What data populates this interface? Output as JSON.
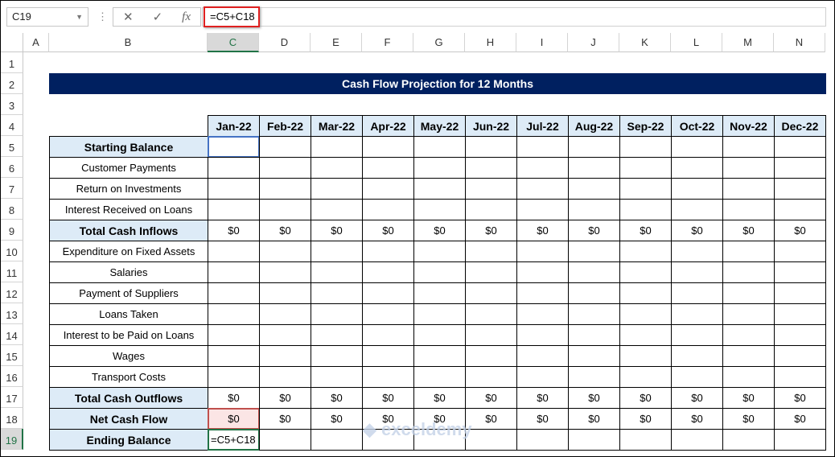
{
  "name_box": "C19",
  "formula_bar": {
    "cancel_icon": "✕",
    "enter_icon": "✓",
    "fx_label": "fx",
    "formula": "=C5+C18"
  },
  "columns": [
    "A",
    "B",
    "C",
    "D",
    "E",
    "F",
    "G",
    "H",
    "I",
    "J",
    "K",
    "L",
    "M",
    "N"
  ],
  "rows": [
    "1",
    "2",
    "3",
    "4",
    "5",
    "6",
    "7",
    "8",
    "9",
    "10",
    "11",
    "12",
    "13",
    "14",
    "15",
    "16",
    "17",
    "18",
    "19"
  ],
  "selected_cell": "C19",
  "sheet": {
    "title": "Cash Flow Projection for 12 Months",
    "months": [
      "Jan-22",
      "Feb-22",
      "Mar-22",
      "Apr-22",
      "May-22",
      "Jun-22",
      "Jul-22",
      "Aug-22",
      "Sep-22",
      "Oct-22",
      "Nov-22",
      "Dec-22"
    ],
    "line_items": [
      {
        "label": "Starting Balance",
        "bold": true,
        "values": [
          "",
          "",
          "",
          "",
          "",
          "",
          "",
          "",
          "",
          "",
          "",
          ""
        ]
      },
      {
        "label": "Customer Payments",
        "bold": false,
        "values": [
          "",
          "",
          "",
          "",
          "",
          "",
          "",
          "",
          "",
          "",
          "",
          ""
        ]
      },
      {
        "label": "Return on Investments",
        "bold": false,
        "values": [
          "",
          "",
          "",
          "",
          "",
          "",
          "",
          "",
          "",
          "",
          "",
          ""
        ]
      },
      {
        "label": "Interest Received on Loans",
        "bold": false,
        "values": [
          "",
          "",
          "",
          "",
          "",
          "",
          "",
          "",
          "",
          "",
          "",
          ""
        ]
      },
      {
        "label": "Total Cash Inflows",
        "bold": true,
        "values": [
          "$0",
          "$0",
          "$0",
          "$0",
          "$0",
          "$0",
          "$0",
          "$0",
          "$0",
          "$0",
          "$0",
          "$0"
        ]
      },
      {
        "label": "Expenditure on Fixed Assets",
        "bold": false,
        "values": [
          "",
          "",
          "",
          "",
          "",
          "",
          "",
          "",
          "",
          "",
          "",
          ""
        ]
      },
      {
        "label": "Salaries",
        "bold": false,
        "values": [
          "",
          "",
          "",
          "",
          "",
          "",
          "",
          "",
          "",
          "",
          "",
          ""
        ]
      },
      {
        "label": "Payment of Suppliers",
        "bold": false,
        "values": [
          "",
          "",
          "",
          "",
          "",
          "",
          "",
          "",
          "",
          "",
          "",
          ""
        ]
      },
      {
        "label": "Loans Taken",
        "bold": false,
        "values": [
          "",
          "",
          "",
          "",
          "",
          "",
          "",
          "",
          "",
          "",
          "",
          ""
        ]
      },
      {
        "label": "Interest to be Paid on Loans",
        "bold": false,
        "values": [
          "",
          "",
          "",
          "",
          "",
          "",
          "",
          "",
          "",
          "",
          "",
          ""
        ]
      },
      {
        "label": "Wages",
        "bold": false,
        "values": [
          "",
          "",
          "",
          "",
          "",
          "",
          "",
          "",
          "",
          "",
          "",
          ""
        ]
      },
      {
        "label": "Transport Costs",
        "bold": false,
        "values": [
          "",
          "",
          "",
          "",
          "",
          "",
          "",
          "",
          "",
          "",
          "",
          ""
        ]
      },
      {
        "label": "Total Cash Outflows",
        "bold": true,
        "values": [
          "$0",
          "$0",
          "$0",
          "$0",
          "$0",
          "$0",
          "$0",
          "$0",
          "$0",
          "$0",
          "$0",
          "$0"
        ]
      },
      {
        "label": "Net Cash Flow",
        "bold": true,
        "values": [
          "$0",
          "$0",
          "$0",
          "$0",
          "$0",
          "$0",
          "$0",
          "$0",
          "$0",
          "$0",
          "$0",
          "$0"
        ]
      },
      {
        "label": "Ending Balance",
        "bold": true,
        "values": [
          "=C5+C18",
          "",
          "",
          "",
          "",
          "",
          "",
          "",
          "",
          "",
          "",
          ""
        ]
      }
    ]
  },
  "watermark": "exceldemy"
}
